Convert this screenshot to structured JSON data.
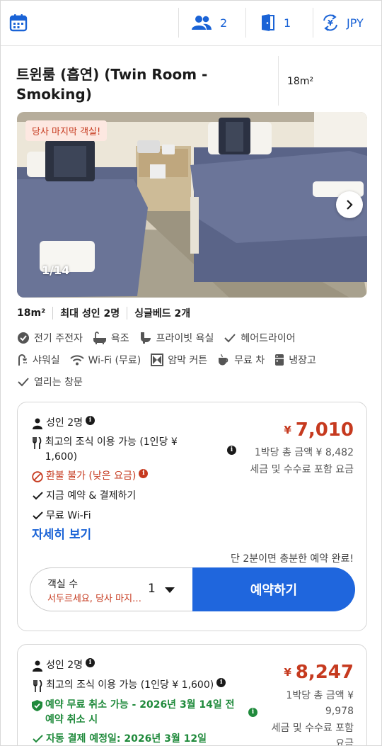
{
  "topbar": {
    "guests": "2",
    "rooms": "1",
    "currency": "JPY"
  },
  "room": {
    "title": "트윈룸 (흡연) (Twin Room - Smoking)",
    "size": "18m²"
  },
  "photo": {
    "badge": "당사 마지막 객실!",
    "counter": "1/14"
  },
  "specs": [
    "18m²",
    "최대 성인 2명",
    "싱글베드 2개"
  ],
  "amenities": {
    "row1": [
      "전기 주전자",
      "욕조",
      "프라이빗 욕실",
      "헤어드라이어"
    ],
    "row2": [
      "샤워실",
      "Wi-Fi (무료)",
      "암막 커튼",
      "무료 차",
      "냉장고"
    ],
    "row3": [
      "열리는 창문"
    ]
  },
  "offers": [
    {
      "adults": "성인 2명",
      "breakfast": "최고의 조식 이용 가능 (1인당 ¥ 1,600)",
      "policy": "환불 불가 (낮은 요금)",
      "perk1": "지금 예약 & 결제하기",
      "perk2": "무료 Wi-Fi",
      "details_link": "자세히 보기",
      "currency_symbol": "¥",
      "price": "7,010",
      "total_line": "1박당 총 금액 ¥ 8,482",
      "tax_note": "세금 및 수수료 포함 요금",
      "quick_note": "단 2분이면 충분한 예약 완료!",
      "room_count_label": "객실 수",
      "room_count_hurry": "서두르세요, 당사 마지막 객실!",
      "room_count_value": "1",
      "book_button": "예약하기"
    },
    {
      "adults": "성인 2명",
      "breakfast": "최고의 조식 이용 가능 (1인당 ¥ 1,600)",
      "policy": "예약 무료 취소 가능 - 2026년 3월 14일 전 예약 취소 시",
      "payment": "자동 결제 예정일: 2026년 3월 12일",
      "currency_symbol": "¥",
      "price": "8,247",
      "total_line": "1박당 총 금액 ¥ 9,978",
      "tax_note": "세금 및 수수료 포함 요금"
    }
  ],
  "colors": {
    "brand_blue": "#1f66dd",
    "price_red": "#c63a1f",
    "success_green": "#1f8a3b"
  }
}
